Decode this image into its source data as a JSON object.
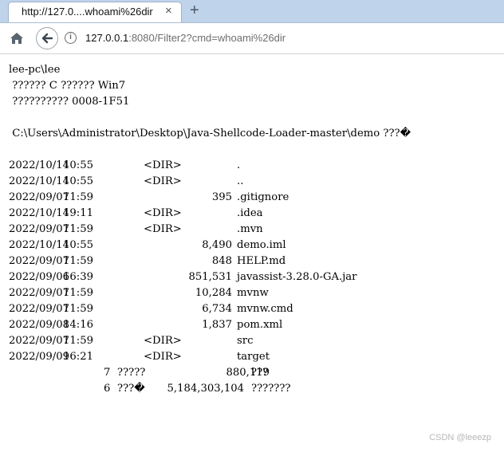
{
  "browser": {
    "tab_title": "http://127.0....whoami%26dir",
    "tab_close": "×",
    "new_tab": "+",
    "url_host": "127.0.0.1",
    "url_rest": ":8080/Filter2?cmd=whoami%26dir"
  },
  "output": {
    "user": "lee-pc\\lee",
    "volume_line": " ?????? C ?????? Win7",
    "serial_line": " ?????????? 0008-1F51",
    "dir_line": " C:\\Users\\Administrator\\Desktop\\Java-Shellcode-Loader-master\\demo ???�",
    "entries": [
      {
        "date": "2022/10/14",
        "time": "10:55",
        "dir": "<DIR>",
        "size": "",
        "name": "."
      },
      {
        "date": "2022/10/14",
        "time": "10:55",
        "dir": "<DIR>",
        "size": "",
        "name": ".."
      },
      {
        "date": "2022/09/07",
        "time": "11:59",
        "dir": "",
        "size": "395",
        "name": ".gitignore"
      },
      {
        "date": "2022/10/14",
        "time": "19:11",
        "dir": "<DIR>",
        "size": "",
        "name": ".idea"
      },
      {
        "date": "2022/09/07",
        "time": "11:59",
        "dir": "<DIR>",
        "size": "",
        "name": ".mvn"
      },
      {
        "date": "2022/10/14",
        "time": "10:55",
        "dir": "",
        "size": "8,490",
        "name": "demo.iml"
      },
      {
        "date": "2022/09/07",
        "time": "11:59",
        "dir": "",
        "size": "848",
        "name": "HELP.md"
      },
      {
        "date": "2022/09/06",
        "time": "16:39",
        "dir": "",
        "size": "851,531",
        "name": "javassist-3.28.0-GA.jar"
      },
      {
        "date": "2022/09/07",
        "time": "11:59",
        "dir": "",
        "size": "10,284",
        "name": "mvnw"
      },
      {
        "date": "2022/09/07",
        "time": "11:59",
        "dir": "",
        "size": "6,734",
        "name": "mvnw.cmd"
      },
      {
        "date": "2022/09/08",
        "time": "14:16",
        "dir": "",
        "size": "1,837",
        "name": "pom.xml"
      },
      {
        "date": "2022/09/07",
        "time": "11:59",
        "dir": "<DIR>",
        "size": "",
        "name": "src"
      },
      {
        "date": "2022/09/09",
        "time": "16:21",
        "dir": "<DIR>",
        "size": "",
        "name": "target"
      }
    ],
    "summary_files": {
      "count": "7",
      "label": "?????",
      "value": "880,119",
      "unit": "???"
    },
    "summary_dirs": {
      "count": "6",
      "label": "???�",
      "value": "5,184,303,104",
      "unit": "???????"
    }
  },
  "watermark": "CSDN @leeezp"
}
